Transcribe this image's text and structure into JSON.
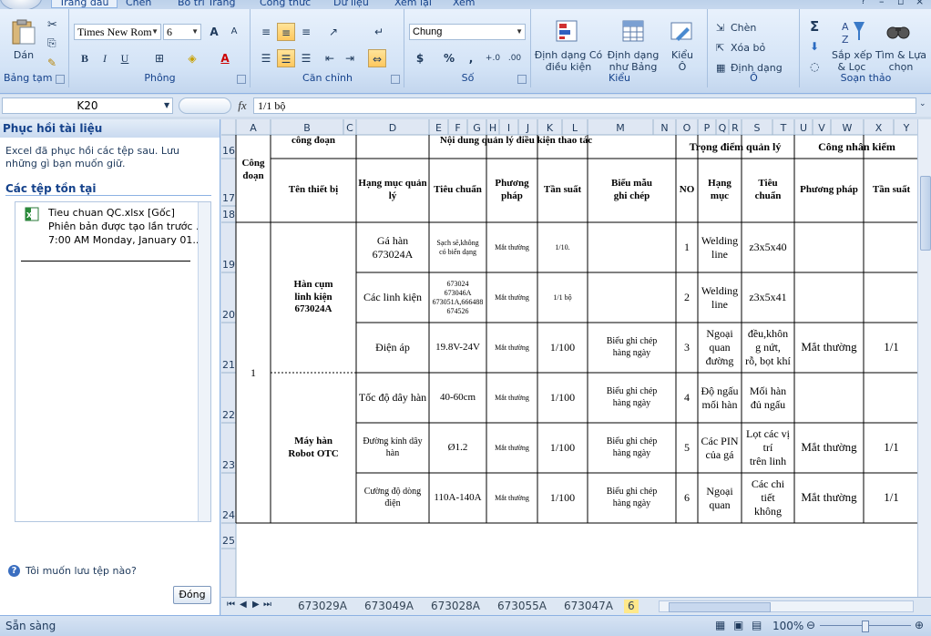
{
  "tabs": [
    "Trang đầu",
    "Chèn",
    "Bố trí Trang",
    "Công thức",
    "Dữ liệu",
    "Xem lại",
    "Xem"
  ],
  "ribbon": {
    "clipboard": {
      "paste": "Dán",
      "label": "Bảng tạm"
    },
    "font": {
      "name": "Times New Rom",
      "size": "6",
      "label": "Phông",
      "bold": "B",
      "italic": "I",
      "underline": "U",
      "grow": "A",
      "shrink": "A"
    },
    "alignment": {
      "label": "Căn chỉnh"
    },
    "number": {
      "format": "Chung",
      "currency": "$",
      "percent": "%",
      "comma": ",",
      "inc": "+.0",
      "dec": ".00",
      "label": "Số"
    },
    "styles": {
      "cond": "Định dạng Có\nđiều kiện",
      "table": "Định dạng\nnhư Bảng",
      "cellstyle": "Kiểu\nÔ",
      "label": "Kiểu"
    },
    "cells": {
      "insert": "Chèn",
      "delete": "Xóa bỏ",
      "format": "Định dạng",
      "label": "Ô"
    },
    "editing": {
      "sort": "Sắp xếp\n& Lọc",
      "find": "Tìm & Lựa\nchọn",
      "sum": "Σ",
      "label": "Soạn thảo"
    }
  },
  "formula": {
    "cell_ref": "K20",
    "fx": "fx",
    "value": "1/1 bộ"
  },
  "pane": {
    "title": "Phục hồi tài liệu",
    "desc": "Excel đã phục hồi các tệp sau.  Lưu những gì bạn muốn giữ.",
    "section": "Các tệp tồn tại",
    "file_name": "Tieu chuan QC.xlsx  [Gốc]",
    "file_line2": "Phiên bản được tạo lần trước ...",
    "file_line3": "7:00 AM Monday, January 01...",
    "help": "Tôi muốn lưu tệp nào?",
    "close": "Đóng"
  },
  "columns": [
    "A",
    "B",
    "C",
    "D",
    "E",
    "F",
    "G",
    "H",
    "I",
    "J",
    "K",
    "L",
    "M",
    "N",
    "O",
    "P",
    "Q",
    "R",
    "S",
    "T",
    "U",
    "V",
    "W",
    "X",
    "Y"
  ],
  "rows": [
    "16",
    "17",
    "18",
    "19",
    "20",
    "21",
    "22",
    "23",
    "24",
    "25"
  ],
  "sheet": {
    "h_congdoan_top": "công đoạn",
    "h_noidung": "Nội dung quản lý điều kiện thao tác",
    "h_trongdiem": "Trọng điểm quản lý",
    "h_congnhan": "Công nhân kiểm",
    "h_congdoan": "Công\nđoạn",
    "h_tenthietbi": "Tên thiết bị",
    "h_hangmucql": "Hạng mục quản\nlý",
    "h_tieuchuan": "Tiêu chuẩn",
    "h_phuongphap": "Phương\npháp",
    "h_tansuat": "Tần suất",
    "h_bieumau": "Biểu mẫu\nghi chép",
    "h_no": "NO",
    "h_hangmuc": "Hạng\nmục",
    "h_tieuchuan2": "Tiêu\nchuẩn",
    "h_phuongphap2": "Phương pháp",
    "h_tansuat2": "Tần suất",
    "stage_no": "1",
    "device1": "Hàn cụm\nlinh kiện\n673024A",
    "device2": "Máy hàn\nRobot OTC",
    "items": [
      {
        "hm": "Gá hàn 673024A",
        "tc": "Sạch sẽ,không\ncó biến dạng",
        "pp": "Mắt thường",
        "ts": "1/10.",
        "bm": "",
        "no": "1",
        "hm2": "Welding\nline",
        "tc2": "z3x5x40",
        "pp2": "",
        "ts2": ""
      },
      {
        "hm": "Các linh kiện",
        "tc": "673024\n673046A\n673051A,666488\n674526",
        "pp": "Mắt thường",
        "ts": "1/1 bộ",
        "bm": "",
        "no": "2",
        "hm2": "Welding\nline",
        "tc2": "z3x5x41",
        "pp2": "",
        "ts2": ""
      },
      {
        "hm": "Điện áp",
        "tc": "19.8V-24V",
        "pp": "Mắt thường",
        "ts": "1/100",
        "bm": "Biểu ghi chép\nhàng ngày",
        "no": "3",
        "hm2": "Ngoại\nquan\nđường",
        "tc2": "đều,khôn\ng nứt,\nrỗ, bọt khí",
        "pp2": "Mắt thường",
        "ts2": "1/1"
      },
      {
        "hm": "Tốc độ dây hàn",
        "tc": "40-60cm",
        "pp": "Mắt thường",
        "ts": "1/100",
        "bm": "Biểu ghi chép\nhàng ngày",
        "no": "4",
        "hm2": "Độ ngấu\nmối hàn",
        "tc2": "Mối hàn\nđủ ngấu",
        "pp2": "",
        "ts2": ""
      },
      {
        "hm": "Đường kính dây hàn",
        "tc": "Ø1.2",
        "pp": "Mắt thường",
        "ts": "1/100",
        "bm": "Biểu ghi chép\nhàng ngày",
        "no": "5",
        "hm2": "Các PIN\ncủa gá",
        "tc2": "Lọt các vị\ntrí\ntrên linh",
        "pp2": "Mắt thường",
        "ts2": "1/1"
      },
      {
        "hm": "Cường độ dòng điện",
        "tc": "110A-140A",
        "pp": "Mắt thường",
        "ts": "1/100",
        "bm": "Biểu ghi chép\nhàng ngày",
        "no": "6",
        "hm2": "Ngoại quan",
        "tc2": "Các chi\ntiết\nkhông",
        "pp2": "Mắt thường",
        "ts2": "1/1"
      }
    ]
  },
  "sheet_tabs": [
    "673029A",
    "673049A",
    "673028A",
    "673055A",
    "673047A",
    "6"
  ],
  "status": {
    "ready": "Sẵn sàng",
    "zoom": "100%"
  }
}
